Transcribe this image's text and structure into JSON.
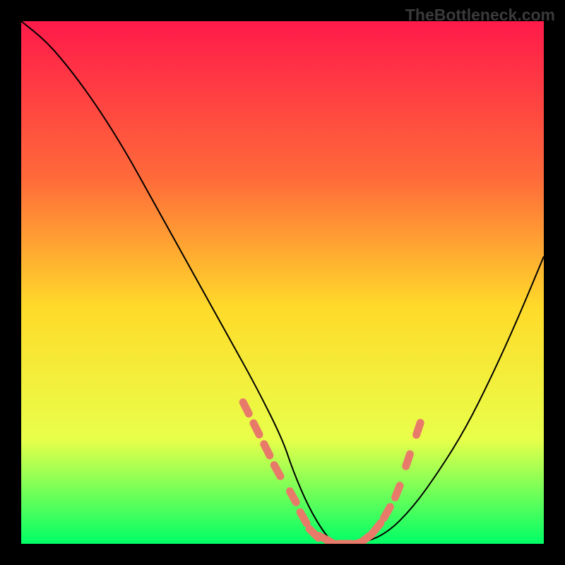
{
  "watermark": "TheBottleneck.com",
  "chart_data": {
    "type": "line",
    "title": "",
    "xlabel": "",
    "ylabel": "",
    "xlim": [
      0,
      100
    ],
    "ylim": [
      0,
      100
    ],
    "gradient_background": {
      "top_color": "#ff1a4a",
      "upper_mid_color": "#ff6a3a",
      "mid_color": "#ffdb2a",
      "lower_mid_color": "#e8ff4a",
      "bottom_color": "#00ff66"
    },
    "series": [
      {
        "name": "bottleneck-curve",
        "color": "#000000",
        "x": [
          0,
          5,
          10,
          15,
          20,
          25,
          30,
          35,
          40,
          45,
          50,
          52,
          55,
          58,
          60,
          65,
          70,
          75,
          80,
          85,
          90,
          95,
          100
        ],
        "y": [
          100,
          96,
          90,
          83,
          75,
          66,
          57,
          48,
          39,
          30,
          20,
          14,
          7,
          2,
          0,
          0,
          2,
          7,
          14,
          22,
          32,
          43,
          55
        ]
      }
    ],
    "markers": {
      "name": "highlight-dots",
      "color": "#e87a6a",
      "shape": "rounded-dash",
      "x": [
        43,
        45,
        47,
        49,
        52,
        54,
        56,
        58,
        60,
        62,
        64,
        66,
        68,
        70,
        72,
        74,
        76
      ],
      "y": [
        26,
        22,
        18,
        14,
        9,
        5,
        2,
        1,
        0,
        0,
        0,
        1,
        3,
        6,
        10,
        16,
        22
      ]
    }
  }
}
